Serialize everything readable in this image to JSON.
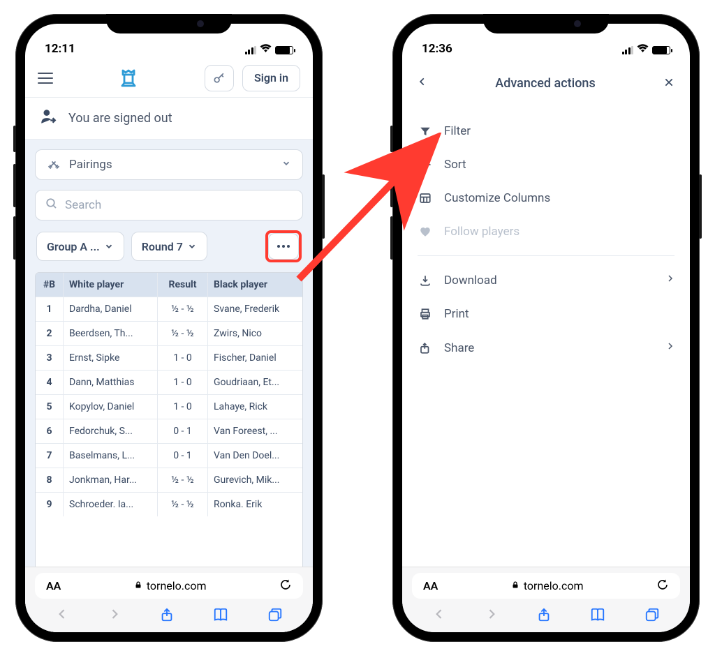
{
  "phone1": {
    "time": "12:11",
    "signin_label": "Sign in",
    "banner_text": "You are signed out",
    "pairings_label": "Pairings",
    "search_placeholder": "Search",
    "group_label": "Group A ...",
    "round_label": "Round 7",
    "table_headers": {
      "board": "#B",
      "white": "White player",
      "result": "Result",
      "black": "Black player"
    },
    "rows": [
      {
        "b": "1",
        "w": "Dardha, Daniel",
        "r": "½ - ½",
        "k": "Svane, Frederik"
      },
      {
        "b": "2",
        "w": "Beerdsen, Th...",
        "r": "½ - ½",
        "k": "Zwirs, Nico"
      },
      {
        "b": "3",
        "w": "Ernst, Sipke",
        "r": "1 - 0",
        "k": "Fischer, Daniel"
      },
      {
        "b": "4",
        "w": "Dann, Matthias",
        "r": "1 - 0",
        "k": "Goudriaan, Et..."
      },
      {
        "b": "5",
        "w": "Kopylov, Daniel",
        "r": "1 - 0",
        "k": "Lahaye, Rick"
      },
      {
        "b": "6",
        "w": "Fedorchuk, S...",
        "r": "0 - 1",
        "k": "Van Foreest, ..."
      },
      {
        "b": "7",
        "w": "Baselmans, L...",
        "r": "0 - 1",
        "k": "Van Den Doel..."
      },
      {
        "b": "8",
        "w": "Jonkman, Har...",
        "r": "½ - ½",
        "k": "Gurevich, Mik..."
      },
      {
        "b": "9",
        "w": "Schroeder. Ia...",
        "r": "½ - ½",
        "k": "Ronka. Erik"
      }
    ],
    "url": "tornelo.com",
    "aa": "AA"
  },
  "phone2": {
    "time": "12:36",
    "title": "Advanced actions",
    "items_a": [
      {
        "id": "filter",
        "label": "Filter",
        "disabled": false
      },
      {
        "id": "sort",
        "label": "Sort",
        "disabled": false
      },
      {
        "id": "columns",
        "label": "Customize Columns",
        "disabled": false
      },
      {
        "id": "follow",
        "label": "Follow players",
        "disabled": true
      }
    ],
    "items_b": [
      {
        "id": "download",
        "label": "Download",
        "chev": true
      },
      {
        "id": "print",
        "label": "Print",
        "chev": false
      },
      {
        "id": "share",
        "label": "Share",
        "chev": true
      }
    ],
    "url": "tornelo.com",
    "aa": "AA"
  }
}
